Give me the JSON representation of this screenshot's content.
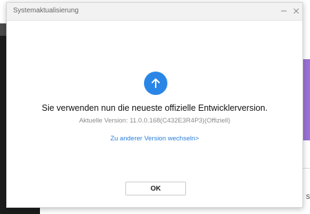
{
  "dialog": {
    "title": "Systemaktualisierung",
    "minimize_icon": "minus-icon",
    "close_icon": "close-icon",
    "status_icon": "arrow-up-icon",
    "accent_color": "#2a86e6",
    "headline": "Sie verwenden nun die neueste offizielle Entwicklerversion.",
    "version_text": "Aktuelle Version: 11.0.0.168(C432E3R4P3)(Offiziell)",
    "switch_link": "Zu anderer Version wechseln>",
    "ok_label": "OK"
  },
  "background": {
    "right_edge_letter": "S"
  }
}
